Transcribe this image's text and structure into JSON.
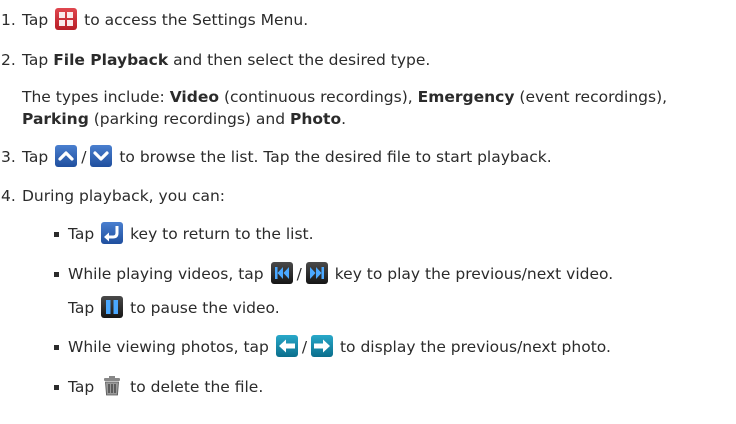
{
  "steps": {
    "s1": {
      "num": "1.",
      "pre": "Tap",
      "icon": "settings-menu-icon",
      "post": "to access the Settings Menu."
    },
    "s2": {
      "num": "2.",
      "pre": "Tap",
      "bold": "File Playback",
      "post": "and then select the desired type.",
      "types_intro": "The types include:",
      "types": {
        "video": "Video",
        "video_desc": "(continuous recordings),",
        "emergency": "Emergency",
        "emergency_desc": "(event recordings),",
        "parking": "Parking",
        "parking_desc": "(parking recordings) and",
        "photo": "Photo",
        "end": "."
      }
    },
    "s3": {
      "num": "3.",
      "pre": "Tap",
      "sep": "/",
      "icons": [
        "up-arrow-icon",
        "down-arrow-icon"
      ],
      "post": "to browse the list. Tap the desired file to start playback."
    },
    "s4": {
      "num": "4.",
      "text": "During playback, you can:",
      "bullets": {
        "b1": {
          "pre": "Tap",
          "icon": "return-icon",
          "post": "key to return to the list."
        },
        "b2": {
          "pre": "While playing videos, tap",
          "sep": "/",
          "icons": [
            "previous-video-icon",
            "next-video-icon"
          ],
          "post": "key to play the previous/next video.",
          "line2_pre": "Tap",
          "line2_icon": "pause-icon",
          "line2_post": "to pause the video."
        },
        "b3": {
          "pre": "While viewing photos, tap",
          "sep": "/",
          "icons": [
            "previous-photo-icon",
            "next-photo-icon"
          ],
          "post": "to display the previous/next photo."
        },
        "b4": {
          "pre": "Tap",
          "icon": "trash-icon",
          "post": "to delete the file."
        }
      }
    }
  }
}
